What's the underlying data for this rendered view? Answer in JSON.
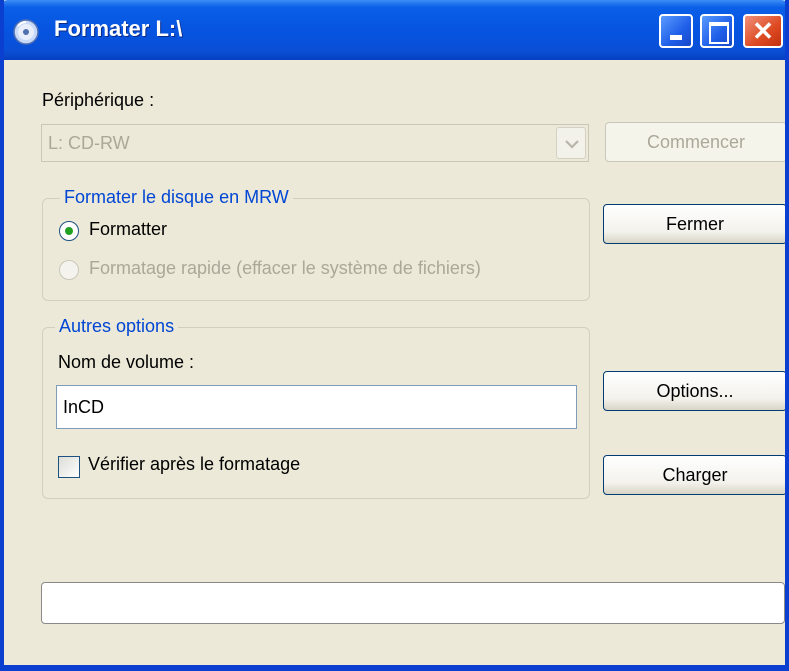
{
  "window": {
    "title": "Formater L:\\",
    "close_glyph": "✕"
  },
  "device": {
    "label": "Périphérique :",
    "selected": "L: CD-RW"
  },
  "buttons": {
    "start": "Commencer",
    "close": "Fermer",
    "options": "Options...",
    "load": "Charger"
  },
  "format_group": {
    "legend": "Formater le disque en MRW",
    "option_full": "Formatter",
    "option_quick": "Formatage rapide (effacer le système de fichiers)",
    "selected": "Formatter"
  },
  "other_group": {
    "legend": "Autres options",
    "volume_label": "Nom de volume :",
    "volume_value": "InCD",
    "verify_label": "Vérifier après le formatage",
    "verify_checked": false
  },
  "progress": {
    "value": 0
  },
  "icons": {
    "app": "cd-drive-icon",
    "minimize": "minimize-icon",
    "maximize": "maximize-icon",
    "close": "close-icon",
    "dropdown": "chevron-down-icon"
  },
  "colors": {
    "titlebar": "#0653e0",
    "window_bg": "#ece9d8",
    "group_legend": "#0046d5",
    "close_button": "#dd4a22"
  }
}
